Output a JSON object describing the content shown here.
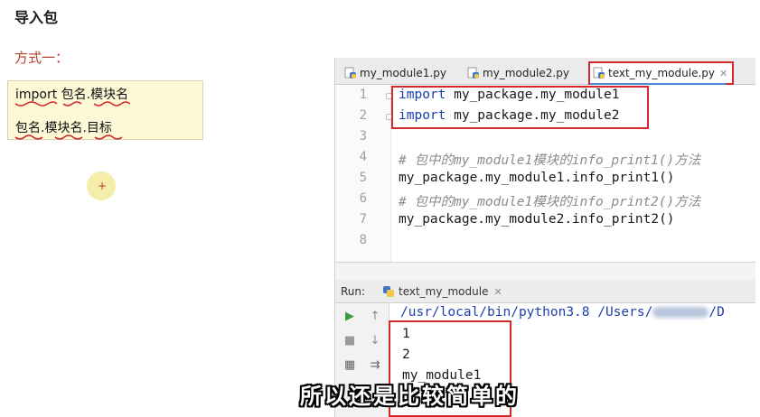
{
  "notes": {
    "heading": "导入包",
    "method_label": "方式一：",
    "syntax_line1": "import 包名.模块名",
    "syntax_line2": "包名.模块名.目标"
  },
  "editor": {
    "tabs": [
      {
        "label": "my_module1.py",
        "active": false
      },
      {
        "label": "my_module2.py",
        "active": false
      },
      {
        "label": "text_my_module.py",
        "active": true
      }
    ],
    "line_numbers": [
      "1",
      "2",
      "3",
      "4",
      "5",
      "6",
      "7",
      "8"
    ],
    "lines": [
      {
        "kw": "import",
        "rest": " my_package.my_module1"
      },
      {
        "kw": "import",
        "rest": " my_package.my_module2"
      },
      {
        "text": ""
      },
      {
        "comment": "# 包中的my_module1模块的info_print1()方法"
      },
      {
        "text": "my_package.my_module1.info_print1()"
      },
      {
        "comment": "# 包中的my_module1模块的info_print2()方法"
      },
      {
        "text": "my_package.my_module2.info_print2()"
      },
      {
        "text": ""
      }
    ]
  },
  "run_panel": {
    "label": "Run:",
    "tab_label": "text_my_module",
    "command_prefix": "/usr/local/bin/python3.8 /Users/",
    "command_suffix": "/D",
    "output": [
      "1",
      "2",
      "my_module1"
    ]
  },
  "subtitle": "所以还是比较简单的",
  "colors": {
    "highlight_box": "#d22a2a",
    "keyword": "#1a3fb0",
    "comment": "#8c8c8c",
    "method_label": "#b2402e",
    "note_bg": "#fdf8d6"
  },
  "icons": {
    "tab_file": "python-file-icon",
    "tab_close": "close-icon",
    "run_play": "play-icon",
    "run_stop": "stop-icon",
    "scroll_up": "arrow-up-icon",
    "scroll_down": "arrow-down-icon",
    "soft_wrap": "wrap-icon",
    "layout": "layout-icon"
  }
}
